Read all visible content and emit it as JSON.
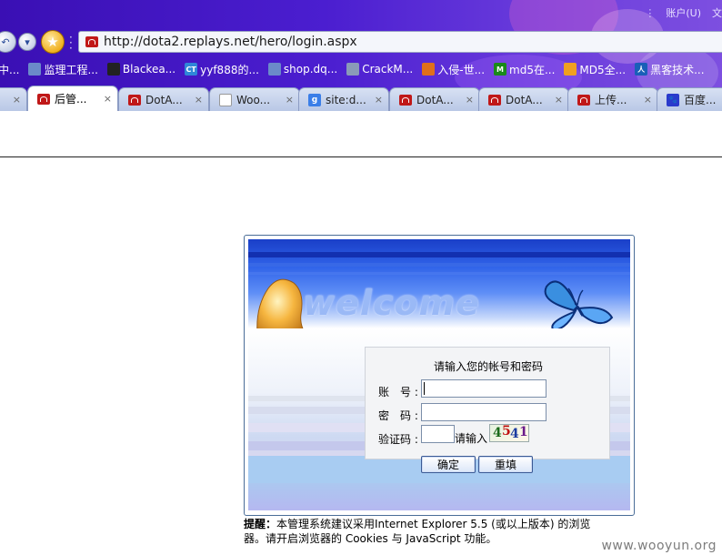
{
  "window": {
    "account_menu": "账户(U)",
    "right_glyph": "文"
  },
  "nav": {
    "url": "http://dota2.replays.net/hero/login.aspx",
    "back_glyph": "↶",
    "menu_glyph": "▾",
    "star_glyph": "★"
  },
  "bookmarks": [
    {
      "label": "中...",
      "icon": "folder-icon",
      "color": "#3a5fc8"
    },
    {
      "label": "监理工程...",
      "icon": "page-icon",
      "color": "#6b8ac9"
    },
    {
      "label": "Blackea...",
      "icon": "blackeagle-icon",
      "color": "#222222"
    },
    {
      "label": "yyf888的...",
      "icon": "ct-icon",
      "color": "#2f86d8",
      "icon_text": "CT"
    },
    {
      "label": "shop.dq...",
      "icon": "page-icon",
      "color": "#6b8ac9"
    },
    {
      "label": "CrackM...",
      "icon": "image-icon",
      "color": "#8a9ab8"
    },
    {
      "label": "入侵-世...",
      "icon": "firefox-icon",
      "color": "#e0701a"
    },
    {
      "label": "md5在...",
      "icon": "md5-icon",
      "color": "#1a8a1a",
      "icon_text": "M"
    },
    {
      "label": "MD5全...",
      "icon": "md5-orange-icon",
      "color": "#f0a020"
    },
    {
      "label": "黑客技术...",
      "icon": "hacker-icon",
      "color": "#1a5fb8",
      "icon_text": "人"
    }
  ],
  "tabs": [
    {
      "label": "",
      "icon": "none",
      "active": false
    },
    {
      "label": "后管...",
      "icon": "site-icon",
      "active": true
    },
    {
      "label": "DotA...",
      "icon": "site-icon",
      "active": false
    },
    {
      "label": "Woo...",
      "icon": "blank-page-icon",
      "active": false
    },
    {
      "label": "site:d...",
      "icon": "google-icon",
      "active": false,
      "icon_text": "g"
    },
    {
      "label": "DotA...",
      "icon": "site-icon",
      "active": false
    },
    {
      "label": "DotA...",
      "icon": "site-icon",
      "active": false
    },
    {
      "label": "上传...",
      "icon": "site-icon",
      "active": false
    },
    {
      "label": "百度...",
      "icon": "baidu-icon",
      "active": false,
      "icon_text": "🐾"
    }
  ],
  "tab_close_glyph": "×",
  "login": {
    "banner_text": "welcome",
    "form_title": "请输入您的帐号和密码",
    "account_label": "账　号 :",
    "password_label": "密　码 :",
    "captcha_label": "验证码 :",
    "account_value": "",
    "password_value": "",
    "captcha_value": "",
    "captcha_hint": "请输入",
    "captcha_chars": [
      "4",
      "5",
      "4",
      "1"
    ],
    "submit_label": "确定",
    "reset_label": "重填"
  },
  "notice": {
    "prefix": "提醒：",
    "line1": "本管理系统建议采用Internet Explorer 5.5 (或以上版本) 的浏览",
    "line2": "器。请开启浏览器的 Cookies 与 JavaScript 功能。"
  },
  "watermark": "www.wooyun.org"
}
